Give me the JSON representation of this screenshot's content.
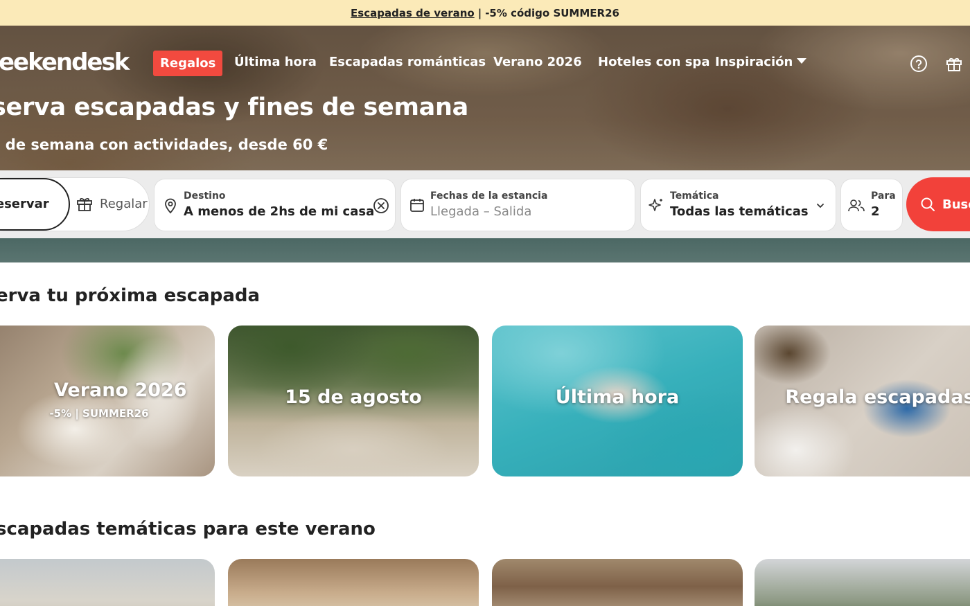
{
  "promo": {
    "link": "Escapadas de verano",
    "separator": "|",
    "text": "-5% código SUMMER26"
  },
  "nav": {
    "logo": "eekendesk",
    "items": [
      {
        "label": "Regalos"
      },
      {
        "label": "Última hora"
      },
      {
        "label": "Escapadas románticas"
      },
      {
        "label": "Verano 2026"
      },
      {
        "label": "Hoteles con spa"
      },
      {
        "label": "Inspiración"
      }
    ],
    "icons": [
      "help-circle-icon",
      "gift-icon"
    ]
  },
  "hero": {
    "title": "serva escapadas y fines de semana",
    "subtitle": "s de semana con actividades, desde 60 €"
  },
  "search": {
    "toggle_reservar": "Reservar",
    "toggle_regalar": "Regalar",
    "destino_label": "Destino",
    "destino_value": "A menos de 2hs de mi casa",
    "fechas_label": "Fechas de la estancia",
    "fechas_placeholder": "Llegada – Salida",
    "tematica_label": "Temática",
    "tematica_value": "Todas las temáticas",
    "para_label": "Para",
    "para_value": "2",
    "button": "Busc"
  },
  "section1": {
    "title": "erva tu próxima escapada",
    "cards": [
      {
        "title": "Verano 2026",
        "subtitle": "-5% | SUMMER26"
      },
      {
        "title": "15 de agosto"
      },
      {
        "title": "Última hora"
      },
      {
        "title": "Regala escapadas"
      }
    ]
  },
  "section2": {
    "title": "scapadas temáticas para este verano"
  },
  "colors": {
    "accent": "#f24a3f",
    "promo_bg": "#fbeab8"
  }
}
